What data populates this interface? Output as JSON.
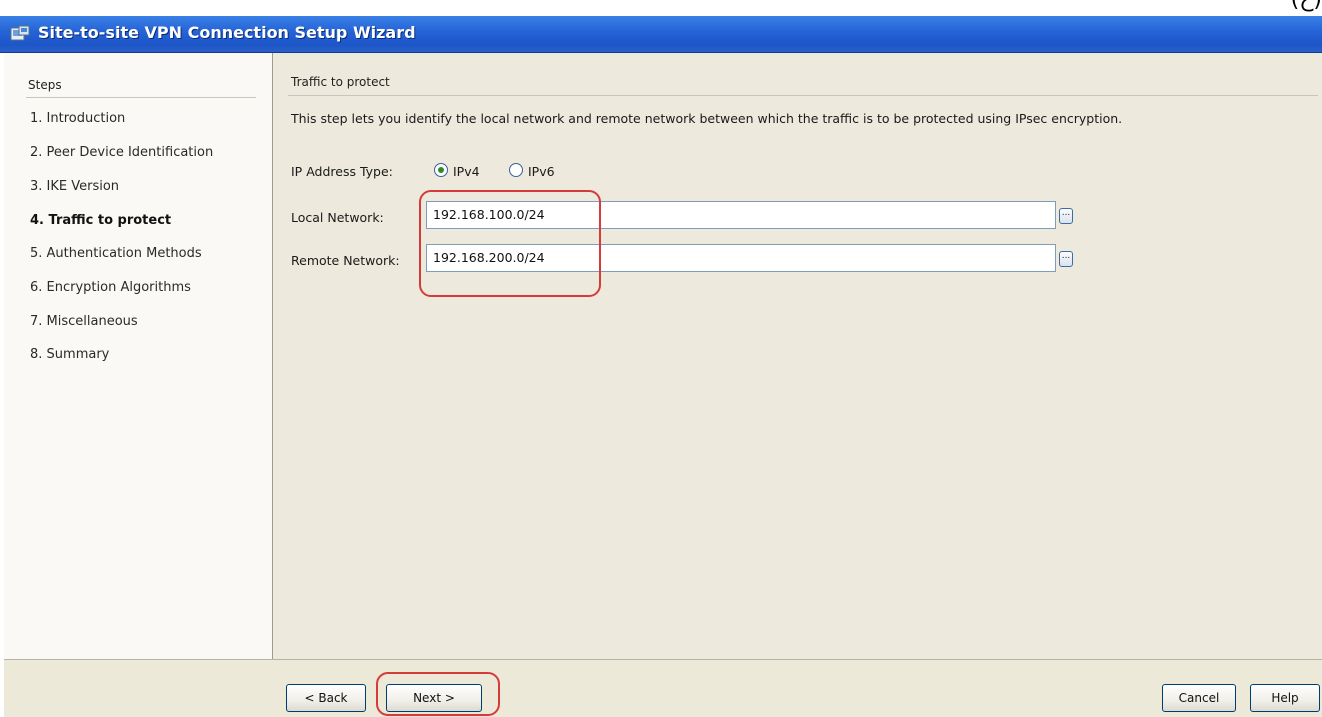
{
  "window": {
    "title": "Site-to-site VPN Connection Setup Wizard",
    "corner_text": "(ح)"
  },
  "steps_panel": {
    "title": "Steps",
    "items": [
      {
        "label": "1.  Introduction",
        "active": false
      },
      {
        "label": "2.  Peer Device Identification",
        "active": false
      },
      {
        "label": "3.  IKE Version",
        "active": false
      },
      {
        "label": "4.  Traffic to protect",
        "active": true
      },
      {
        "label": "5.  Authentication Methods",
        "active": false
      },
      {
        "label": "6.  Encryption Algorithms",
        "active": false
      },
      {
        "label": "7.  Miscellaneous",
        "active": false
      },
      {
        "label": "8.  Summary",
        "active": false
      }
    ]
  },
  "main": {
    "section_title": "Traffic to protect",
    "description": "This step lets you identify the local network and remote network between which the traffic is to be protected using IPsec encryption.",
    "ip_type": {
      "label": "IP Address Type:",
      "options": [
        {
          "label": "IPv4",
          "selected": true
        },
        {
          "label": "IPv6",
          "selected": false
        }
      ]
    },
    "local_network": {
      "label": "Local Network:",
      "value": "192.168.100.0/24"
    },
    "remote_network": {
      "label": "Remote Network:",
      "value": "192.168.200.0/24"
    },
    "browse_glyph": "..."
  },
  "buttons": {
    "back": "< Back",
    "next": "Next >",
    "cancel": "Cancel",
    "help": "Help"
  },
  "colors": {
    "titlebar": "#2462d6",
    "callout": "#d43b3b",
    "radio_selected": "#2f8a2f"
  }
}
